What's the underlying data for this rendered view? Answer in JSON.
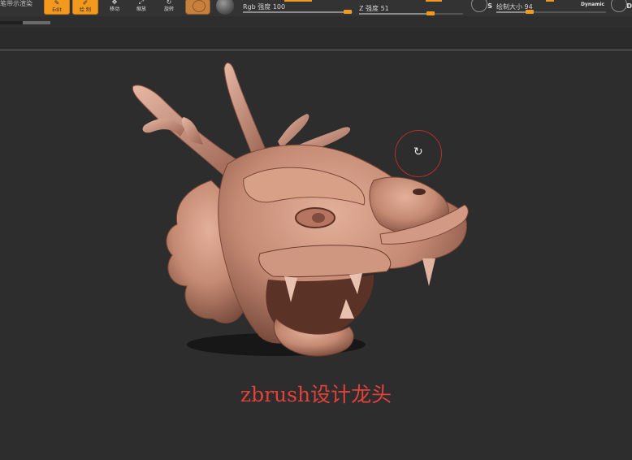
{
  "toolbar": {
    "left_label": "笔带示渲染",
    "buttons": [
      {
        "label": "Edit",
        "icon": "edit-icon",
        "active": true
      },
      {
        "label": "绘 制",
        "icon": "draw-icon",
        "active": true
      },
      {
        "label": "移动",
        "icon": "move-icon",
        "active": false
      },
      {
        "label": "缩放",
        "icon": "scale-icon",
        "active": false
      },
      {
        "label": "旋转",
        "icon": "rotate-icon",
        "active": false
      }
    ],
    "rgb_intensity": {
      "label": "Rgb 强度",
      "value": 100
    },
    "z_intensity": {
      "label": "Z 强度",
      "value": 51
    },
    "draw_size": {
      "label": "绘制大小",
      "value": 94
    },
    "dynamic_label": "Dynamic",
    "s_button": "S",
    "d_button": "D",
    "accent_color": "#f39a1e"
  },
  "canvas": {
    "background": "#2d2d2d",
    "model_color": "#c58a73",
    "gizmo_color": "#b0302b",
    "caption": "zbrush设计龙头"
  }
}
